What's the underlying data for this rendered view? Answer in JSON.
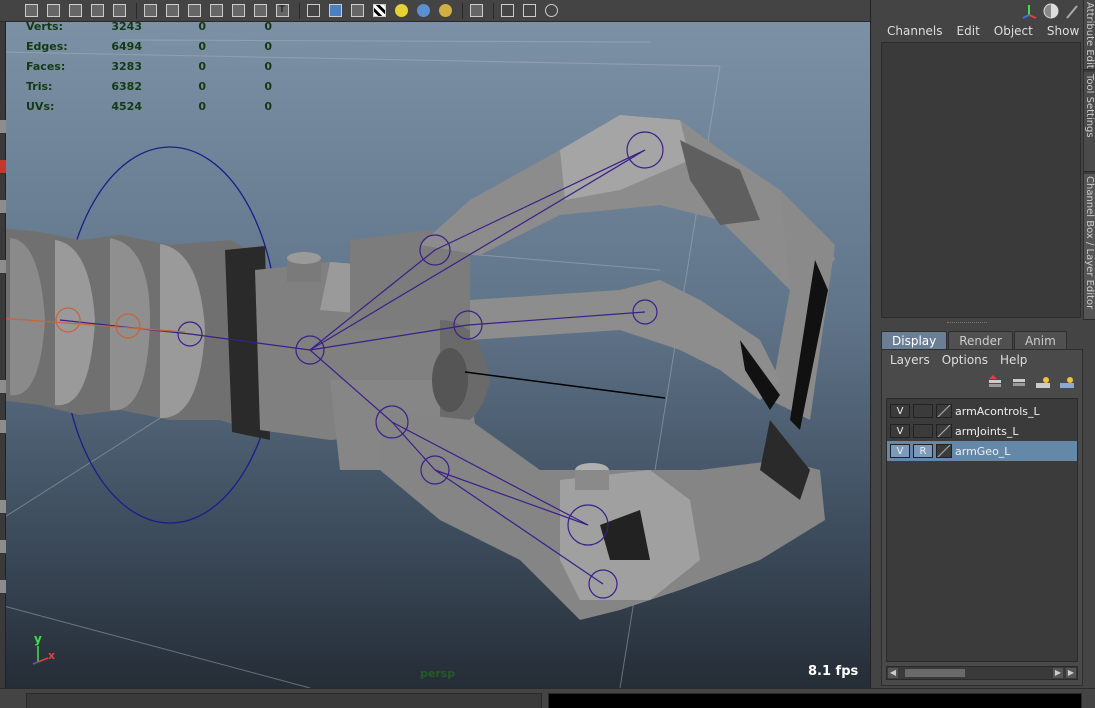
{
  "stats": {
    "rows": [
      {
        "label": "Verts:",
        "v1": "3243",
        "v2": "0",
        "v3": "0"
      },
      {
        "label": "Edges:",
        "v1": "6494",
        "v2": "0",
        "v3": "0"
      },
      {
        "label": "Faces:",
        "v1": "3283",
        "v2": "0",
        "v3": "0"
      },
      {
        "label": "Tris:",
        "v1": "6382",
        "v2": "0",
        "v3": "0"
      },
      {
        "label": "UVs:",
        "v1": "4524",
        "v2": "0",
        "v3": "0"
      }
    ]
  },
  "viewport": {
    "fps": "8.1 fps",
    "camera": "persp",
    "axis_y": "y",
    "axis_x": "x"
  },
  "side_tabs": [
    "Attribute Editor",
    "Tool Settings",
    "Channel Box / Layer Editor"
  ],
  "channel_box": {
    "menu": [
      "Channels",
      "Edit",
      "Object",
      "Show"
    ]
  },
  "layer_editor": {
    "tabs": [
      "Display",
      "Render",
      "Anim"
    ],
    "active_tab": "Display",
    "menu": [
      "Layers",
      "Options",
      "Help"
    ],
    "layers": [
      {
        "v": "V",
        "r": "",
        "name": "armAcontrols_L",
        "selected": false
      },
      {
        "v": "V",
        "r": "",
        "name": "armJoints_L",
        "selected": false
      },
      {
        "v": "V",
        "r": "R",
        "name": "armGeo_L",
        "selected": true
      }
    ]
  },
  "colors": {
    "selection": "#6688a8",
    "joint_color": "#3c1f88",
    "hud_text": "#123b12"
  }
}
